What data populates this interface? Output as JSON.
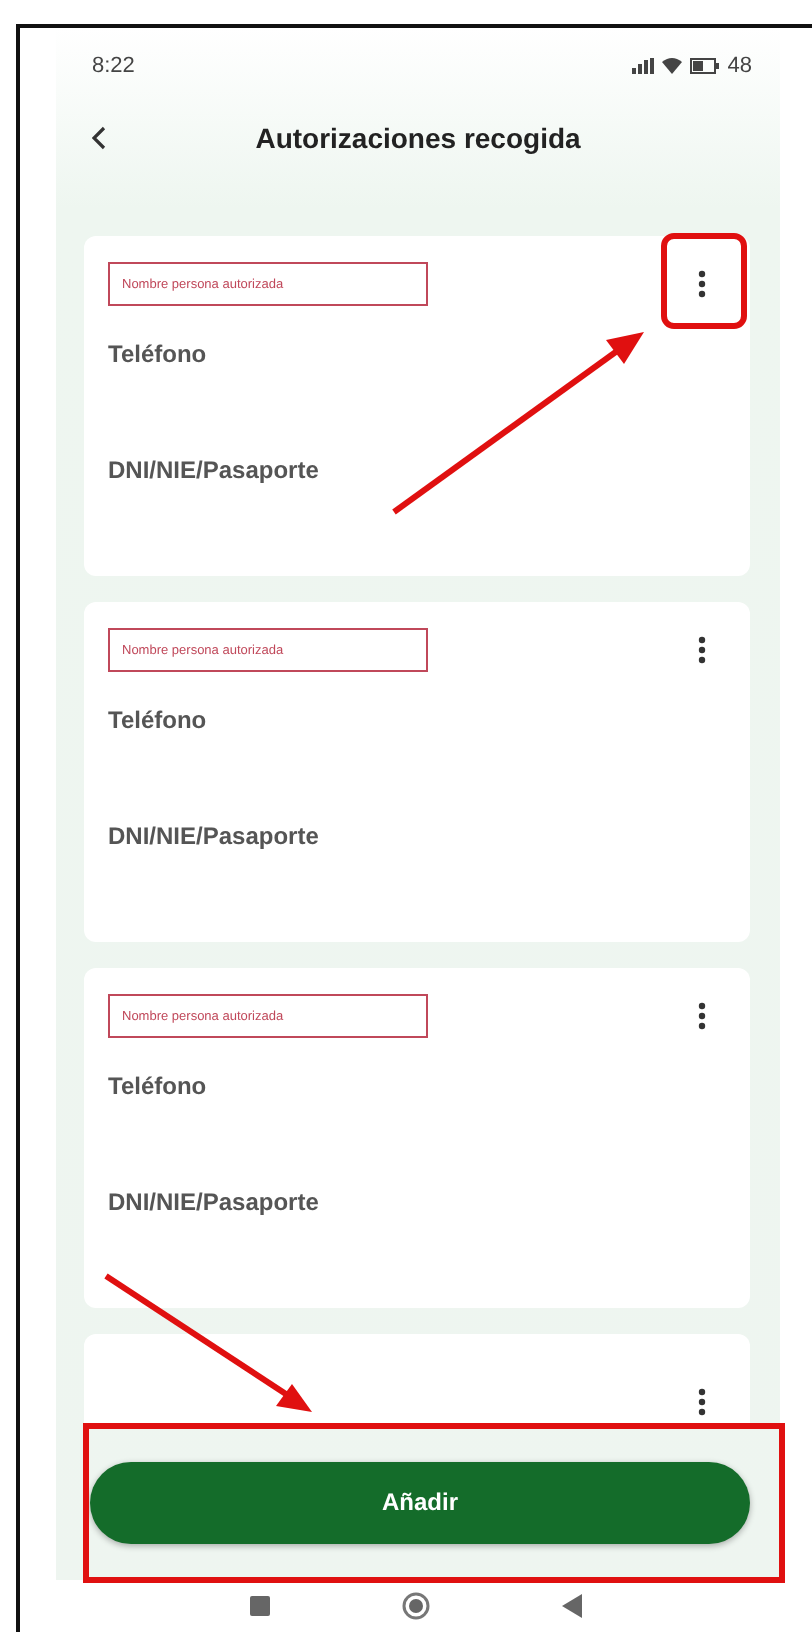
{
  "status_bar": {
    "time": "8:22",
    "battery": "48"
  },
  "header": {
    "title": "Autorizaciones recogida"
  },
  "cards": [
    {
      "kind": "full",
      "name_field": {
        "placeholder": "Nombre persona autorizada"
      },
      "phone_label": "Teléfono",
      "id_label": "DNI/NIE/Pasaporte"
    },
    {
      "kind": "full",
      "name_field": {
        "placeholder": "Nombre persona autorizada"
      },
      "phone_label": "Teléfono",
      "id_label": "DNI/NIE/Pasaporte"
    },
    {
      "kind": "full",
      "name_field": {
        "placeholder": "Nombre persona autorizada"
      },
      "phone_label": "Teléfono",
      "id_label": "DNI/NIE/Pasaporte"
    },
    {
      "kind": "partial"
    }
  ],
  "add_button": {
    "label": "Añadir"
  }
}
